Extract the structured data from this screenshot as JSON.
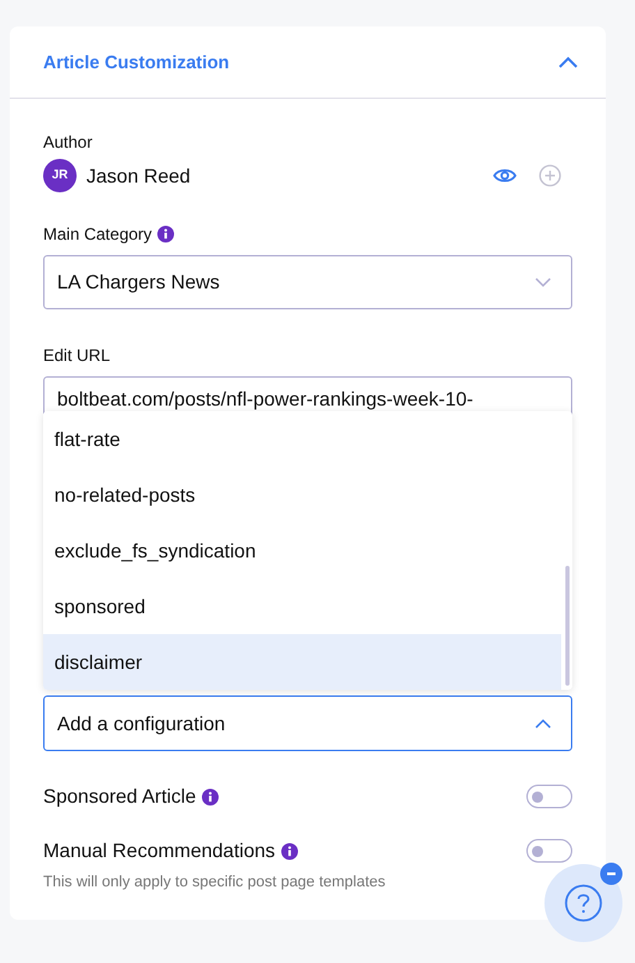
{
  "panel": {
    "title": "Article Customization",
    "expanded": true
  },
  "author": {
    "label": "Author",
    "initials": "JR",
    "name": "Jason Reed"
  },
  "main_category": {
    "label": "Main Category",
    "value": "LA Chargers News"
  },
  "edit_url": {
    "label": "Edit URL",
    "value": "boltbeat.com/posts/nfl-power-rankings-week-10-"
  },
  "configuration": {
    "placeholder": "Add a configuration",
    "expanded": true,
    "options": [
      {
        "label": "flat-rate",
        "selected": false
      },
      {
        "label": "no-related-posts",
        "selected": false
      },
      {
        "label": "exclude_fs_syndication",
        "selected": false
      },
      {
        "label": "sponsored",
        "selected": false
      },
      {
        "label": "disclaimer",
        "selected": true
      }
    ]
  },
  "toggles": [
    {
      "label": "Sponsored Article",
      "on": false
    },
    {
      "label": "Manual Recommendations",
      "on": false,
      "note": "This will only apply to specific post page templates"
    }
  ]
}
